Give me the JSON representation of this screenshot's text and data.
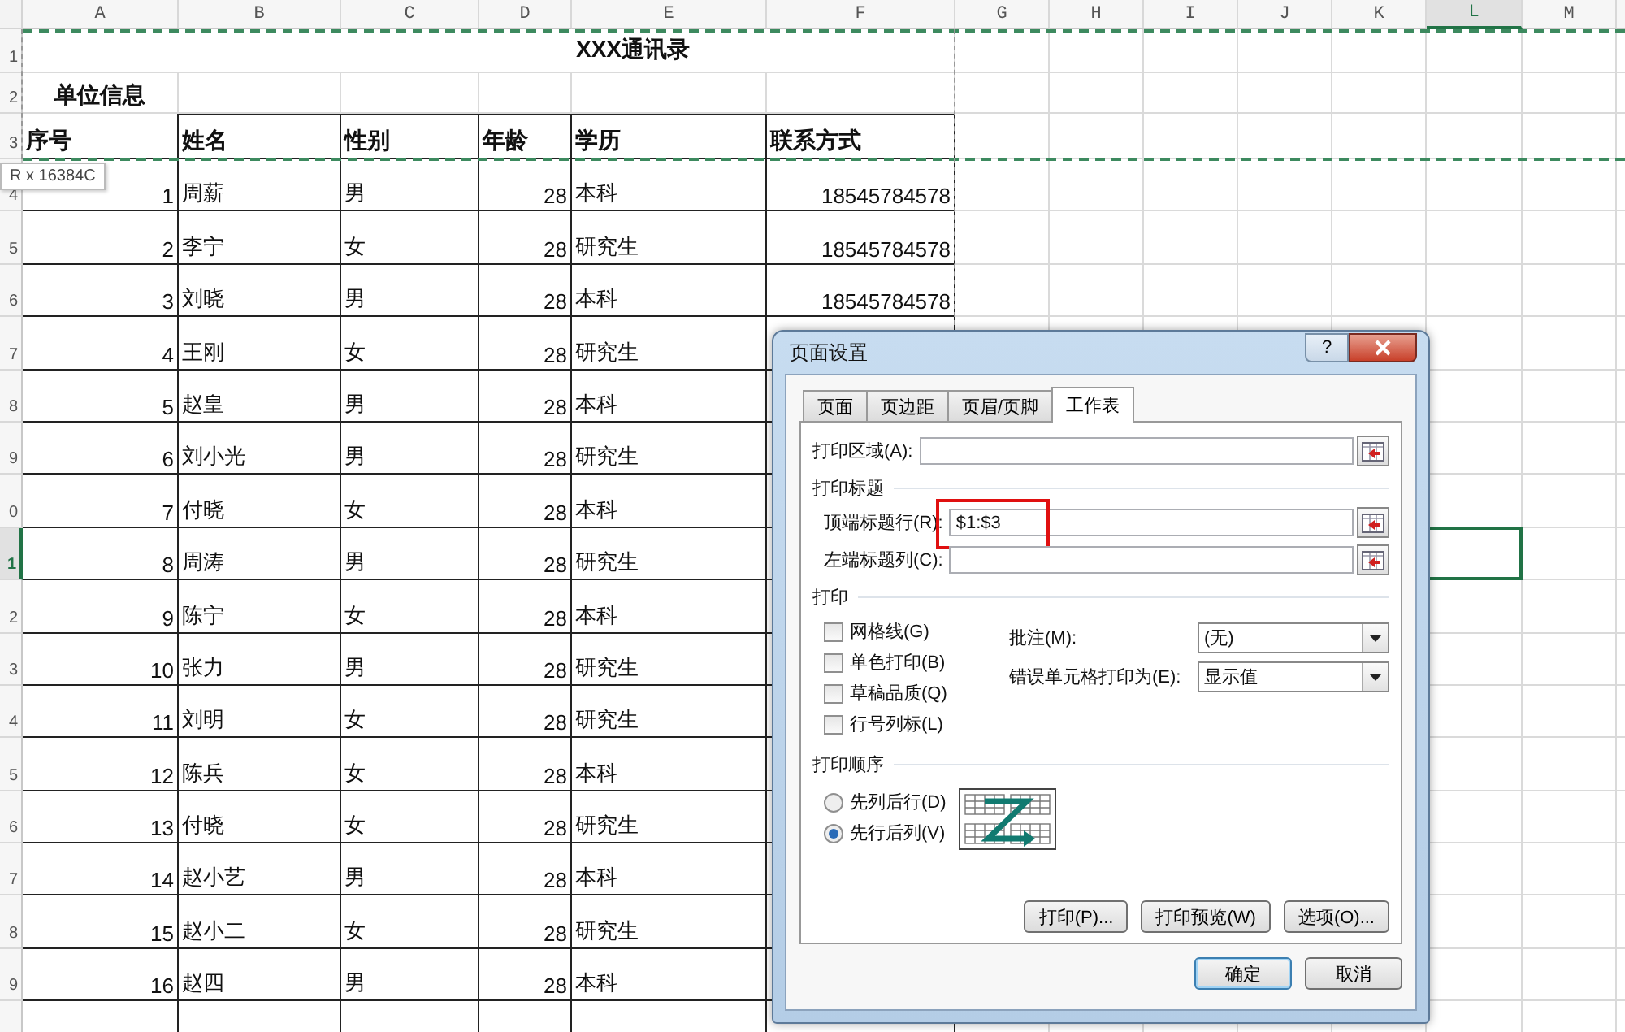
{
  "column_headers": [
    {
      "label": "A",
      "selected": false
    },
    {
      "label": "B",
      "selected": false
    },
    {
      "label": "C",
      "selected": false
    },
    {
      "label": "D",
      "selected": false
    },
    {
      "label": "E",
      "selected": false
    },
    {
      "label": "F",
      "selected": false
    },
    {
      "label": "G",
      "selected": false
    },
    {
      "label": "H",
      "selected": false
    },
    {
      "label": "I",
      "selected": false
    },
    {
      "label": "J",
      "selected": false
    },
    {
      "label": "K",
      "selected": false
    },
    {
      "label": "L",
      "selected": true
    },
    {
      "label": "M",
      "selected": false
    }
  ],
  "row_headers": [
    {
      "label": "1",
      "selected": false
    },
    {
      "label": "2",
      "selected": false
    },
    {
      "label": "3",
      "selected": false
    },
    {
      "label": "4",
      "selected": false
    },
    {
      "label": "5",
      "selected": false
    },
    {
      "label": "6",
      "selected": false
    },
    {
      "label": "7",
      "selected": false
    },
    {
      "label": "8",
      "selected": false
    },
    {
      "label": "9",
      "selected": false
    },
    {
      "label": "0",
      "selected": false
    },
    {
      "label": "1",
      "selected": true
    },
    {
      "label": "2",
      "selected": false
    },
    {
      "label": "3",
      "selected": false
    },
    {
      "label": "4",
      "selected": false
    },
    {
      "label": "5",
      "selected": false
    },
    {
      "label": "6",
      "selected": false
    },
    {
      "label": "7",
      "selected": false
    },
    {
      "label": "8",
      "selected": false
    },
    {
      "label": "9",
      "selected": false
    }
  ],
  "sheet_title": "XXX通讯录",
  "unit_label": "单位信息",
  "tooltip": "R x 16384C",
  "table": {
    "columns": [
      "序号",
      "姓名",
      "性别",
      "年龄",
      "学历",
      "联系方式"
    ],
    "rows": [
      {
        "no": "1",
        "name": "周薪",
        "gender": "男",
        "age": "28",
        "education": "本科",
        "phone": "18545784578"
      },
      {
        "no": "2",
        "name": "李宁",
        "gender": "女",
        "age": "28",
        "education": "研究生",
        "phone": "18545784578"
      },
      {
        "no": "3",
        "name": "刘晓",
        "gender": "男",
        "age": "28",
        "education": "本科",
        "phone": "18545784578"
      },
      {
        "no": "4",
        "name": "王刚",
        "gender": "女",
        "age": "28",
        "education": "研究生"
      },
      {
        "no": "5",
        "name": "赵皇",
        "gender": "男",
        "age": "28",
        "education": "本科"
      },
      {
        "no": "6",
        "name": "刘小光",
        "gender": "男",
        "age": "28",
        "education": "研究生"
      },
      {
        "no": "7",
        "name": "付晓",
        "gender": "女",
        "age": "28",
        "education": "本科"
      },
      {
        "no": "8",
        "name": "周涛",
        "gender": "男",
        "age": "28",
        "education": "研究生"
      },
      {
        "no": "9",
        "name": "陈宁",
        "gender": "女",
        "age": "28",
        "education": "本科"
      },
      {
        "no": "10",
        "name": "张力",
        "gender": "男",
        "age": "28",
        "education": "研究生"
      },
      {
        "no": "11",
        "name": "刘明",
        "gender": "女",
        "age": "28",
        "education": "研究生"
      },
      {
        "no": "12",
        "name": "陈兵",
        "gender": "女",
        "age": "28",
        "education": "本科"
      },
      {
        "no": "13",
        "name": "付晓",
        "gender": "女",
        "age": "28",
        "education": "研究生"
      },
      {
        "no": "14",
        "name": "赵小艺",
        "gender": "男",
        "age": "28",
        "education": "本科"
      },
      {
        "no": "15",
        "name": "赵小二",
        "gender": "女",
        "age": "28",
        "education": "研究生"
      },
      {
        "no": "16",
        "name": "赵四",
        "gender": "男",
        "age": "28",
        "education": "本科"
      }
    ]
  },
  "dialog": {
    "title": "页面设置",
    "help": "?",
    "tabs": [
      {
        "label": "页面",
        "selected": false
      },
      {
        "label": "页边距",
        "selected": false
      },
      {
        "label": "页眉/页脚",
        "selected": false
      },
      {
        "label": "工作表",
        "selected": true
      }
    ],
    "print_area": {
      "label": "打印区域(A):"
    },
    "print_titles": {
      "heading": "打印标题",
      "fields": [
        {
          "label": "顶端标题行(R):",
          "value": "$1:$3",
          "highlighted": true
        },
        {
          "label": "左端标题列(C):",
          "highlighted": false
        }
      ]
    },
    "print": {
      "heading": "打印",
      "checkboxes": [
        {
          "label": "网格线(G)",
          "checked": false
        },
        {
          "label": "单色打印(B)",
          "checked": false
        },
        {
          "label": "草稿品质(Q)",
          "checked": false
        },
        {
          "label": "行号列标(L)",
          "checked": false
        }
      ],
      "dropdowns": [
        {
          "label": "批注(M):",
          "value": "(无)"
        },
        {
          "label": "错误单元格打印为(E):",
          "value": "显示值"
        }
      ]
    },
    "page_order": {
      "heading": "打印顺序",
      "options": [
        {
          "label": "先列后行(D)",
          "selected": false
        },
        {
          "label": "先行后列(V)",
          "selected": true
        }
      ]
    },
    "actions": [
      {
        "label": "打印(P)..."
      },
      {
        "label": "打印预览(W)"
      },
      {
        "label": "选项(O)..."
      }
    ],
    "buttons": [
      {
        "label": "确定",
        "default": true
      },
      {
        "label": "取消",
        "default": false
      }
    ]
  }
}
